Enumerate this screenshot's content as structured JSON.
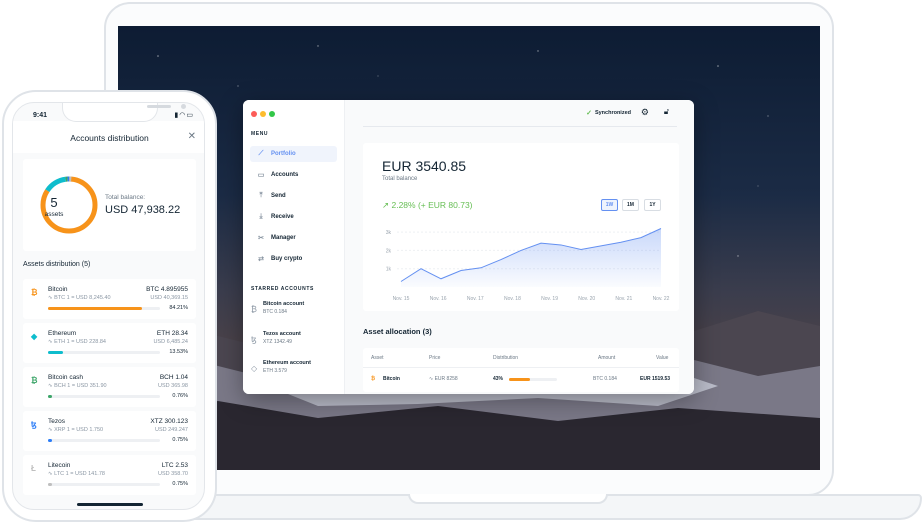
{
  "desktop": {
    "menu_caption": "MENU",
    "nav": [
      {
        "label": "Portfolio",
        "icon": "chart-icon",
        "active": true
      },
      {
        "label": "Accounts",
        "icon": "wallet-icon",
        "active": false
      },
      {
        "label": "Send",
        "icon": "send-icon",
        "active": false
      },
      {
        "label": "Receive",
        "icon": "receive-icon",
        "active": false
      },
      {
        "label": "Manager",
        "icon": "tools-icon",
        "active": false
      },
      {
        "label": "Buy crypto",
        "icon": "exchange-icon",
        "active": false
      }
    ],
    "starred_caption": "STARRED ACCOUNTS",
    "starred": [
      {
        "name": "Bitcoin account",
        "balance": "BTC 0.184",
        "icon": "bitcoin-icon"
      },
      {
        "name": "Tezos account",
        "balance": "XTZ 1342.49",
        "icon": "tezos-icon"
      },
      {
        "name": "Ethereum account",
        "balance": "ETH 3.579",
        "icon": "ethereum-icon"
      }
    ],
    "sync_label": "Synchronized",
    "balance": "EUR 3540.85",
    "balance_label": "Total balance",
    "change": "2.28% (+ EUR 80.73)",
    "ranges": [
      {
        "label": "1W",
        "active": true
      },
      {
        "label": "1M",
        "active": false
      },
      {
        "label": "1Y",
        "active": false
      }
    ],
    "chart_data": {
      "type": "area",
      "x": [
        "Nov. 15",
        "Nov. 16",
        "Nov. 17",
        "Nov. 18",
        "Nov. 19",
        "Nov. 20",
        "Nov. 21",
        "Nov. 22"
      ],
      "y_ticks": [
        "1k",
        "2k",
        "3k"
      ],
      "ylim": [
        0,
        3500
      ],
      "values": [
        300,
        1000,
        450,
        900,
        1050,
        1500,
        2000,
        2400,
        2300,
        2050,
        2250,
        2450,
        2700,
        3200
      ],
      "color": "#6490f1",
      "grid": true
    },
    "allocation_title": "Asset allocation (3)",
    "table": {
      "headers": [
        "Asset",
        "Price",
        "Distribution",
        "Amount",
        "Value"
      ],
      "rows": [
        {
          "asset": "Bitcoin",
          "price": "EUR 8258",
          "distribution": "43%",
          "dist_fraction": 0.43,
          "amount": "BTC 0.184",
          "value": "EUR 1519.53",
          "color": "#f7931a"
        }
      ]
    }
  },
  "phone": {
    "time": "9:41",
    "title": "Accounts distribution",
    "asset_count": "5",
    "asset_count_label": "assets",
    "total_label": "Total balance:",
    "total_value": "USD 47,938.22",
    "assets_title": "Assets distribution (5)",
    "assets": [
      {
        "name": "Bitcoin",
        "price": "BTC 1 = USD 8,245.40",
        "balance": "BTC 4.895955",
        "fiat": "USD 40,369.15",
        "percent": "84.21%",
        "fraction": 0.8421,
        "color": "#f7931a",
        "icon": "bitcoin-icon",
        "glyph": "₿"
      },
      {
        "name": "Ethereum",
        "price": "ETH 1 = USD 228.84",
        "balance": "ETH 28.34",
        "fiat": "USD 6,485.24",
        "percent": "13.53%",
        "fraction": 0.1353,
        "color": "#0ebdcd",
        "icon": "ethereum-icon",
        "glyph": "◆"
      },
      {
        "name": "Bitcoin cash",
        "price": "BCH 1 = USD 351.90",
        "balance": "BCH 1.04",
        "fiat": "USD 365.98",
        "percent": "0.76%",
        "fraction": 0.0076,
        "color": "#3ca569",
        "icon": "bitcoin-cash-icon",
        "glyph": "₿"
      },
      {
        "name": "Tezos",
        "price": "XRP 1 = USD 1.750",
        "balance": "XTZ 300.123",
        "fiat": "USD 249.247",
        "percent": "0.75%",
        "fraction": 0.0075,
        "color": "#2c7df7",
        "icon": "tezos-icon",
        "glyph": "ꜩ"
      },
      {
        "name": "Litecoin",
        "price": "LTC 1 = USD 141.78",
        "balance": "LTC 2.53",
        "fiat": "USD 358.70",
        "percent": "0.75%",
        "fraction": 0.0075,
        "color": "#bfbfbf",
        "icon": "litecoin-icon",
        "glyph": "Ł"
      }
    ]
  }
}
